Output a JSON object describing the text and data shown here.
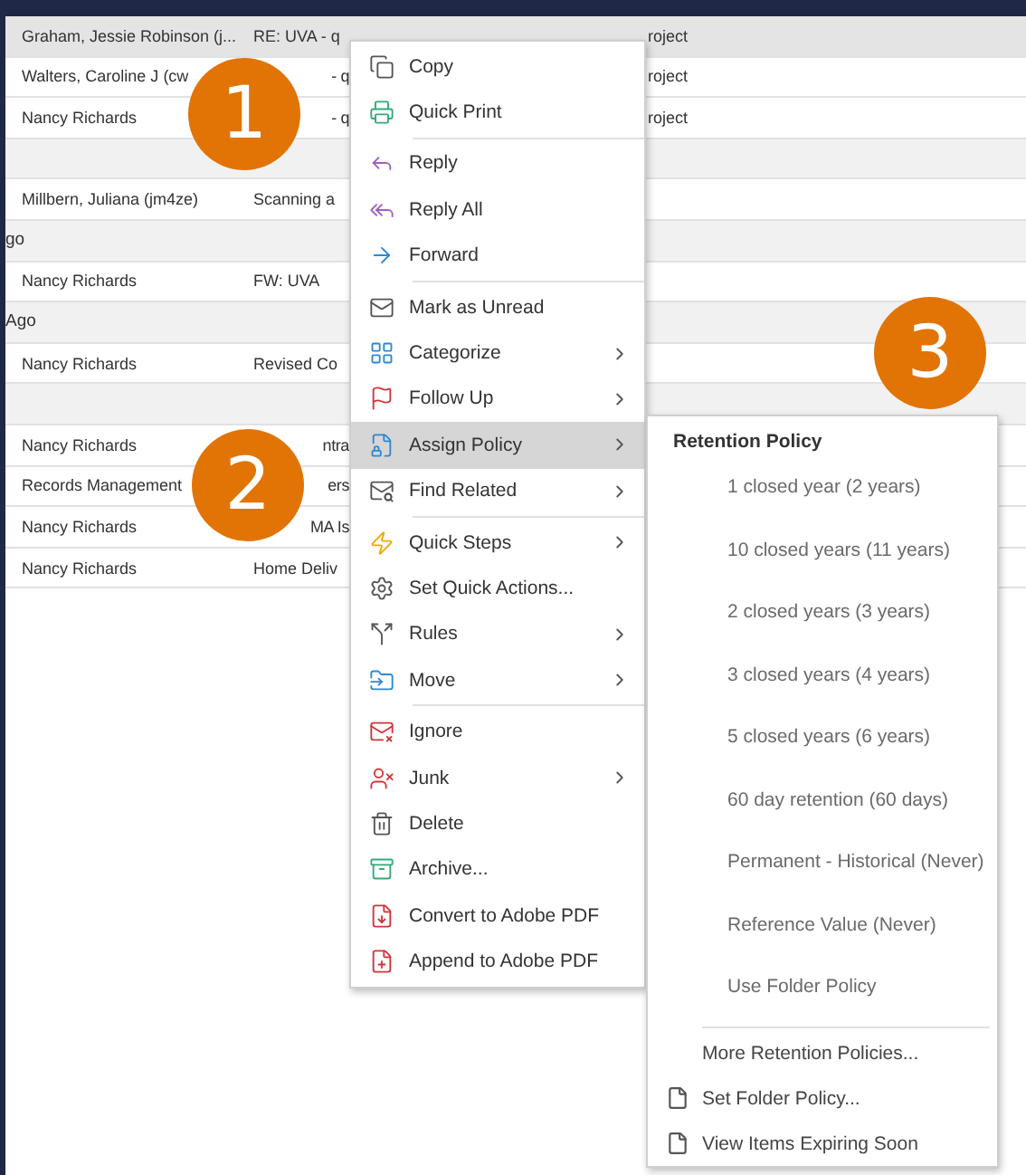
{
  "message_list": {
    "rows": [
      {
        "kind": "message",
        "selected": true,
        "from": "Graham, Jessie Robinson (j...",
        "subject": "RE: UVA - q",
        "subject_tail": "roject"
      },
      {
        "kind": "message",
        "selected": false,
        "from": "Walters, Caroline J (cw",
        "subject_end": "- q",
        "subject_tail": "roject"
      },
      {
        "kind": "message",
        "selected": false,
        "from": "Nancy Richards",
        "subject_end": "- q",
        "subject_tail": "roject"
      },
      {
        "kind": "group"
      },
      {
        "kind": "message",
        "selected": false,
        "from": "Millbern, Juliana (jm4ze)",
        "subject": "Scanning a"
      },
      {
        "kind": "group",
        "label": "go"
      },
      {
        "kind": "message",
        "selected": false,
        "from": "Nancy Richards",
        "subject": "FW: UVA"
      },
      {
        "kind": "group",
        "label": "Ago"
      },
      {
        "kind": "message",
        "selected": false,
        "from": "Nancy Richards",
        "subject": "Revised Co"
      },
      {
        "kind": "group"
      },
      {
        "kind": "message",
        "selected": false,
        "from": "Nancy Richards",
        "subject_end": "ntra"
      },
      {
        "kind": "message",
        "selected": false,
        "from": "Records Management",
        "subject_end": "ers"
      },
      {
        "kind": "message",
        "selected": false,
        "from": "Nancy Richards",
        "subject_end": "MA Is"
      },
      {
        "kind": "message",
        "selected": false,
        "from": "Nancy Richards",
        "subject": "Home Deliv"
      }
    ]
  },
  "context_menu": {
    "groups": [
      [
        {
          "label": "Copy",
          "submenu": false,
          "highlighted": false
        },
        {
          "label": "Quick Print",
          "submenu": false,
          "highlighted": false
        }
      ],
      [
        {
          "label": "Reply",
          "submenu": false,
          "highlighted": false
        },
        {
          "label": "Reply All",
          "submenu": false,
          "highlighted": false
        },
        {
          "label": "Forward",
          "submenu": false,
          "highlighted": false
        }
      ],
      [
        {
          "label": "Mark as Unread",
          "submenu": false,
          "highlighted": false
        },
        {
          "label": "Categorize",
          "submenu": true,
          "highlighted": false
        },
        {
          "label": "Follow Up",
          "submenu": true,
          "highlighted": false
        },
        {
          "label": "Assign Policy",
          "submenu": true,
          "highlighted": true
        },
        {
          "label": "Find Related",
          "submenu": true,
          "highlighted": false
        }
      ],
      [
        {
          "label": "Quick Steps",
          "submenu": true,
          "highlighted": false
        },
        {
          "label": "Set Quick Actions...",
          "submenu": false,
          "highlighted": false
        },
        {
          "label": "Rules",
          "submenu": true,
          "highlighted": false
        },
        {
          "label": "Move",
          "submenu": true,
          "highlighted": false
        }
      ],
      [
        {
          "label": "Ignore",
          "submenu": false,
          "highlighted": false
        },
        {
          "label": "Junk",
          "submenu": true,
          "highlighted": false
        },
        {
          "label": "Delete",
          "submenu": false,
          "highlighted": false
        },
        {
          "label": "Archive...",
          "submenu": false,
          "highlighted": false
        },
        {
          "label": "Convert to Adobe PDF",
          "submenu": false,
          "highlighted": false
        },
        {
          "label": "Append to Adobe PDF",
          "submenu": false,
          "highlighted": false
        }
      ]
    ]
  },
  "policy_submenu": {
    "title": "Retention Policy",
    "policies": [
      "1 closed year (2 years)",
      "10 closed years (11 years)",
      "2 closed years (3 years)",
      "3 closed years (4 years)",
      "5 closed years (6 years)",
      "60 day retention (60 days)",
      "Permanent - Historical (Never)",
      "Reference Value (Never)",
      "Use Folder Policy"
    ],
    "actions": [
      {
        "label": "More Retention Policies...",
        "kind": "plain"
      },
      {
        "label": "Set Folder Policy...",
        "kind": "page"
      },
      {
        "label": "View Items Expiring Soon",
        "kind": "page"
      }
    ]
  },
  "callouts": [
    "1",
    "2",
    "3"
  ]
}
